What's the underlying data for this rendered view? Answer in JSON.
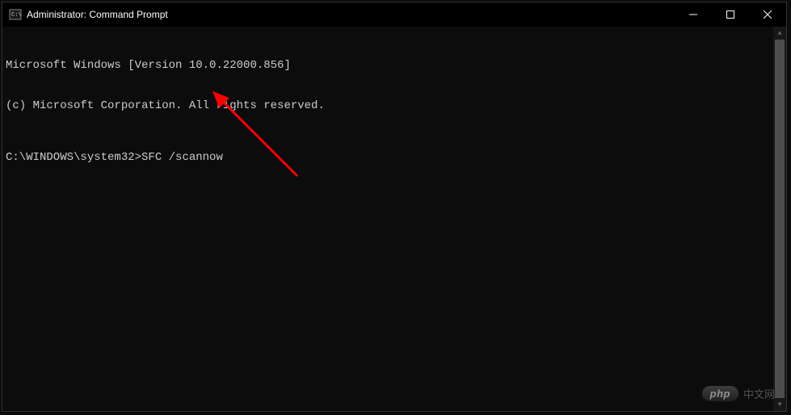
{
  "titlebar": {
    "title": "Administrator: Command Prompt"
  },
  "terminal": {
    "line1": "Microsoft Windows [Version 10.0.22000.856]",
    "line2": "(c) Microsoft Corporation. All rights reserved.",
    "prompt": "C:\\WINDOWS\\system32>",
    "command": "SFC /scannow"
  },
  "watermark": {
    "badge": "php",
    "text": "中文网"
  }
}
